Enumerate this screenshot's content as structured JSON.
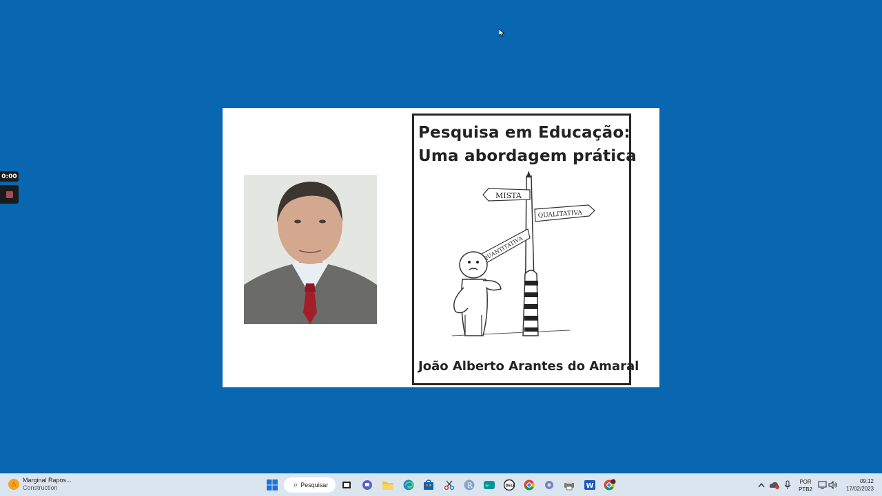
{
  "recorder": {
    "time": "0:00"
  },
  "slide": {
    "book": {
      "title_line1": "Pesquisa em Educação:",
      "title_line2": "Uma abordagem prática",
      "author": "João Alberto Arantes do Amaral",
      "signs": {
        "mista": "MISTA",
        "quantitativa": "QUANTITATIVA",
        "qualitativa": "QUALITATIVA"
      }
    }
  },
  "taskbar": {
    "weather": {
      "title": "Marginal Rapos...",
      "subtitle": "Construction"
    },
    "search": {
      "label": "Pesquisar"
    },
    "pinned": [
      "windows-start",
      "search",
      "task-view",
      "teams-chat",
      "file-explorer",
      "edge",
      "store",
      "snipping-tool",
      "r-app",
      "arduino",
      "dell",
      "chrome",
      "settings",
      "printer",
      "word",
      "chrome-alt"
    ],
    "tray": {
      "lang_line1": "POR",
      "lang_line2": "PTB2",
      "time": "09:12",
      "date": "17/02/2023"
    }
  },
  "colors": {
    "desktop": "#0867b0",
    "taskbar": "#dbe5f0"
  }
}
